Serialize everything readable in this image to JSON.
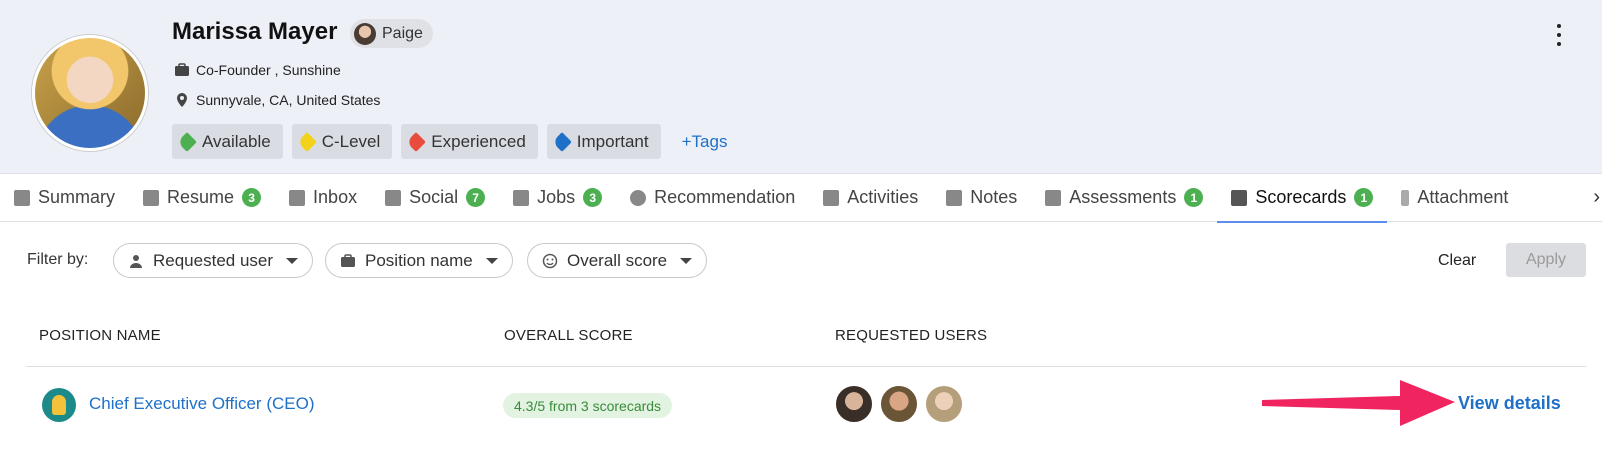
{
  "profile": {
    "name": "Marissa Mayer",
    "owner": "Paige",
    "job": "Co-Founder , Sunshine",
    "location": "Sunnyvale, CA, United States",
    "tags": [
      {
        "label": "Available",
        "color": "#4caf50"
      },
      {
        "label": "C-Level",
        "color": "#f2d21b"
      },
      {
        "label": "Experienced",
        "color": "#e84c3d"
      },
      {
        "label": "Important",
        "color": "#1e70c9"
      }
    ],
    "add_tags": "+Tags"
  },
  "tabs": [
    {
      "label": "Summary",
      "icon": "bookmark-icon"
    },
    {
      "label": "Resume",
      "badge": "3",
      "icon": "document-icon"
    },
    {
      "label": "Inbox",
      "icon": "mail-icon"
    },
    {
      "label": "Social",
      "badge": "7",
      "icon": "share-icon"
    },
    {
      "label": "Jobs",
      "badge": "3",
      "icon": "briefcase-icon"
    },
    {
      "label": "Recommendation",
      "icon": "info-icon"
    },
    {
      "label": "Activities",
      "icon": "calendar-icon"
    },
    {
      "label": "Notes",
      "icon": "comment-icon"
    },
    {
      "label": "Assessments",
      "badge": "1",
      "icon": "grid-icon"
    },
    {
      "label": "Scorecards",
      "badge": "1",
      "icon": "thumbs-icon",
      "active": true
    },
    {
      "label": "Attachment",
      "icon": "paperclip-icon"
    }
  ],
  "filters": {
    "label": "Filter by:",
    "requested_user": "Requested user",
    "position_name": "Position name",
    "overall_score": "Overall score",
    "clear": "Clear",
    "apply": "Apply"
  },
  "table": {
    "headers": [
      "POSITION NAME",
      "OVERALL SCORE",
      "REQUESTED USERS"
    ],
    "rows": [
      {
        "position": "Chief Executive Officer (CEO)",
        "score": "4.3/5 from 3 scorecards",
        "view": "View details"
      }
    ]
  },
  "colors": {
    "accent": "#1e70c9",
    "badge": "#4caf50",
    "annotation_arrow": "#f0245f"
  }
}
